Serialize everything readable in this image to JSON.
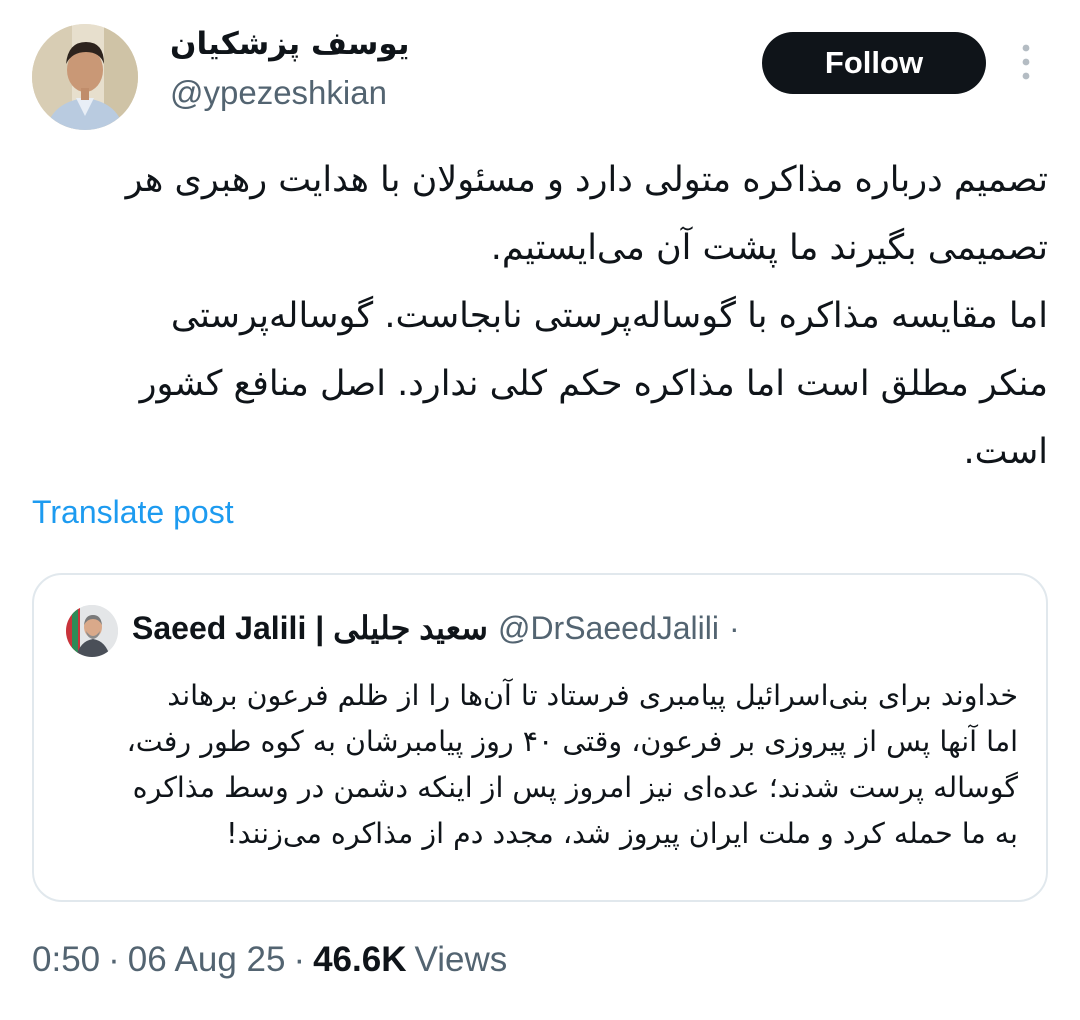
{
  "author": {
    "display_name": "یوسف پزشکیان",
    "handle": "@ypezeshkian",
    "avatar_icon": "user-portrait-avatar"
  },
  "follow_label": "Follow",
  "more_icon": "ellipsis-vertical-icon",
  "tweet": {
    "text": "تصمیم درباره مذاکره متولی دارد و مسئولان با هدایت رهبری هر\nتصمیمی بگیرند ما پشت آن می‌ایستیم.\nاما مقایسه مذاکره با گوساله‌پرستی نابجاست. گوساله‌پرستی\nمنکر مطلق است اما مذاکره حکم کلی ندارد. اصل منافع کشور\nاست."
  },
  "translate_label": "Translate post",
  "quote": {
    "author_name": "Saeed Jalili | سعید جلیلی",
    "author_handle": "@DrSaeedJalili",
    "separator": "·",
    "text": "خداوند برای بنی‌اسرائیل پیامبری فرستاد تا آن‌ها را از ظلم فرعون برهاند\nاما آنها پس از پیروزی بر فرعون، وقتی ۴۰ روز پیامبرشان به کوه طور رفت،\nگوساله پرست شدند؛ عده‌ای نیز امروز پس از اینکه دشمن در وسط مذاکره\nبه ما حمله کرد و ملت ایران پیروز شد، مجدد دم از مذاکره می‌زنند!"
  },
  "meta": {
    "time": "0:50",
    "date": "06 Aug 25",
    "separator": "·",
    "views_count": "46.6K",
    "views_label": "Views"
  },
  "colors": {
    "text": "#0f1419",
    "secondary": "#536471",
    "link": "#1d9bf0",
    "border": "#e1e8ed",
    "button_bg": "#0f1419",
    "button_text": "#ffffff"
  }
}
